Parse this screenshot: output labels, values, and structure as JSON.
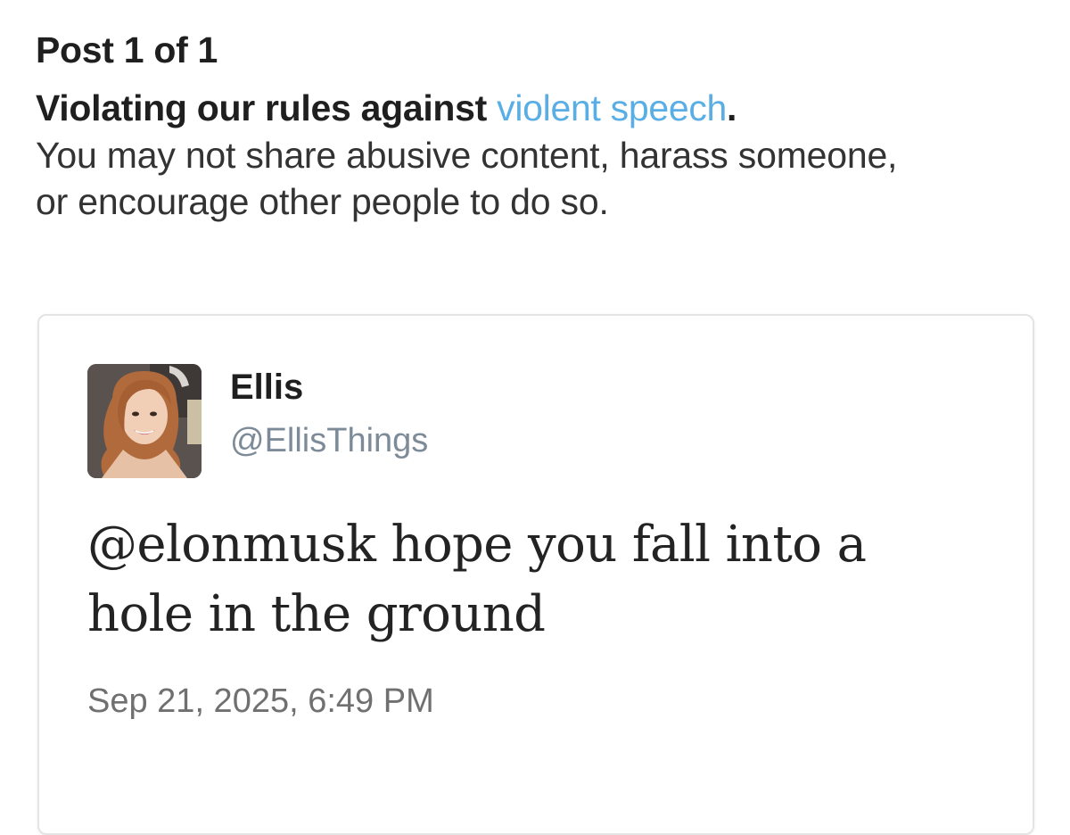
{
  "notice": {
    "post_count": "Post 1 of 1",
    "violation_prefix": "Violating our rules against ",
    "violation_link": "violent speech",
    "violation_suffix": ".",
    "explanation_line1": "You may not share abusive content, harass someone,",
    "explanation_line2": "or encourage other people to do so.",
    "link_color": "#5aaee6"
  },
  "post": {
    "display_name": "Ellis",
    "handle": "@EllisThings",
    "text_line1": "@elonmusk hope you fall into a",
    "text_line2": "hole in the ground",
    "timestamp": "Sep 21, 2025, 6:49 PM",
    "avatar_icon": "user-avatar-photo"
  }
}
